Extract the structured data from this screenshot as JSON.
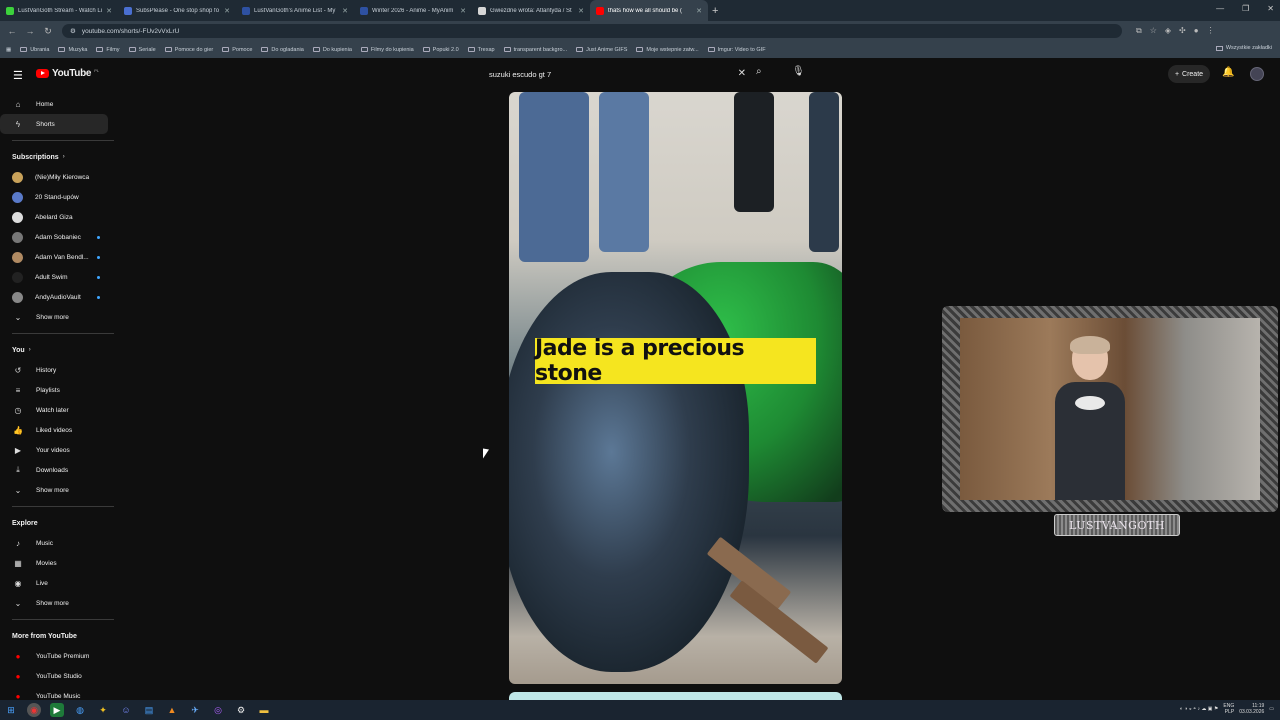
{
  "browser": {
    "tabs": [
      {
        "title": "LustVanGoth Stream - Watch Li",
        "color": "#3cd13c"
      },
      {
        "title": "SubsPlease - One stop shop fo",
        "color": "#4a6fd1"
      },
      {
        "title": "LustVanGoth's Anime List - My",
        "color": "#2e51a2"
      },
      {
        "title": "Winter 2026 - Anime - MyAnim",
        "color": "#2e51a2"
      },
      {
        "title": "Gwiezdne wrota: Atlantyda / St",
        "color": "#d6d6d6"
      },
      {
        "title": "thats how we all should be (",
        "color": "#ff0000"
      }
    ],
    "url": "youtube.com/shorts/-FUv2vVxLrU",
    "bookmarks": [
      "Ubrania",
      "Muzyka",
      "Filmy",
      "Seriale",
      "Pomoce do gier",
      "Pomoce",
      "Do ogladania",
      "Do kupienia",
      "Filmy do kupienia",
      "Popuki 2.0",
      "Trexap",
      "transparent backgro...",
      "Just Anime GIFS",
      "Moje wstepnie zatw...",
      "Imgur: Video to GIF"
    ],
    "bookmarks_right": "Wszystkie zakładki"
  },
  "youtube": {
    "logo": "YouTube",
    "country": "PL",
    "search_query": "suzuki escudo gt 7",
    "create_label": "Create",
    "nav": [
      {
        "label": "Home",
        "icon": "⌂"
      },
      {
        "label": "Shorts",
        "icon": "ϟ"
      }
    ],
    "subscriptions_header": "Subscriptions",
    "subscriptions": [
      {
        "label": "(Nie)Miły Kierowca",
        "color": "#c9a25a",
        "dot": false
      },
      {
        "label": "20 Stand-upów",
        "color": "#5a7ac9",
        "dot": false
      },
      {
        "label": "Abelard Giza",
        "color": "#dddddd",
        "dot": false
      },
      {
        "label": "Adam Sobaniec",
        "color": "#777777",
        "dot": true
      },
      {
        "label": "Adam Van Bendl...",
        "color": "#b08a62",
        "dot": true
      },
      {
        "label": "Adult Swim",
        "color": "#222222",
        "dot": true
      },
      {
        "label": "AndyAudioVault",
        "color": "#888888",
        "dot": true
      }
    ],
    "show_more": "Show more",
    "you_header": "You",
    "you_items": [
      {
        "label": "History",
        "icon": "↺"
      },
      {
        "label": "Playlists",
        "icon": "≡"
      },
      {
        "label": "Watch later",
        "icon": "◷"
      },
      {
        "label": "Liked videos",
        "icon": "👍"
      },
      {
        "label": "Your videos",
        "icon": "▶"
      },
      {
        "label": "Downloads",
        "icon": "⤓"
      }
    ],
    "explore_header": "Explore",
    "explore_items": [
      {
        "label": "Music",
        "icon": "♪"
      },
      {
        "label": "Movies",
        "icon": "▦"
      },
      {
        "label": "Live",
        "icon": "◉"
      }
    ],
    "more_header": "More from YouTube",
    "more_items": [
      {
        "label": "YouTube Premium",
        "color": "#ff0000"
      },
      {
        "label": "YouTube Studio",
        "color": "#ff0000"
      },
      {
        "label": "YouTube Music",
        "color": "#ff0000"
      }
    ]
  },
  "video": {
    "caption": "Jade is a precious stone"
  },
  "webcam": {
    "label": "LUSTVANGOTH"
  },
  "taskbar": {
    "lang": "ENG",
    "lang2": "PLP",
    "time": "11:19",
    "date": "03.03.2026"
  }
}
